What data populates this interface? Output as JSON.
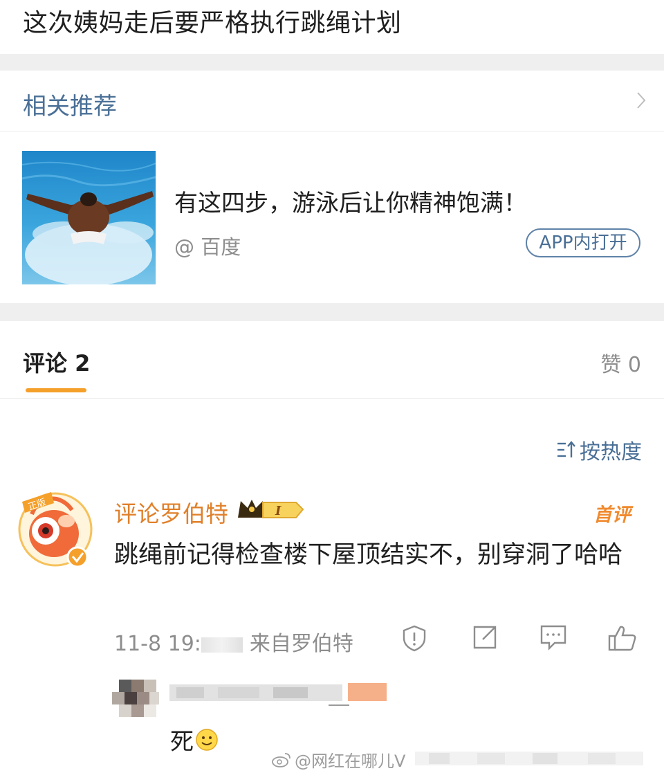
{
  "post": {
    "title": "这次姨妈走后要严格执行跳绳计划"
  },
  "recommend": {
    "header": "相关推荐",
    "article_title": "有这四步，游泳后让你精神饱满！",
    "source": "@ 百度",
    "open_app": "APP内打开"
  },
  "tabs": {
    "comments": "评论 2",
    "likes": "赞 0"
  },
  "sort": {
    "label": "按热度"
  },
  "comment": {
    "username": "评论罗伯特",
    "level_badge": "I",
    "first_badge": "首评",
    "text": "跳绳前记得检查楼下屋顶结实不，别穿洞了哈哈",
    "time": "11-8 19:",
    "source": "来自罗伯特"
  },
  "reply": {
    "text": "死"
  },
  "watermark": {
    "text": "@网红在哪儿V"
  },
  "colors": {
    "link_blue": "#4a6f96",
    "accent_orange": "#f5a02a",
    "username_orange": "#e0802a"
  }
}
